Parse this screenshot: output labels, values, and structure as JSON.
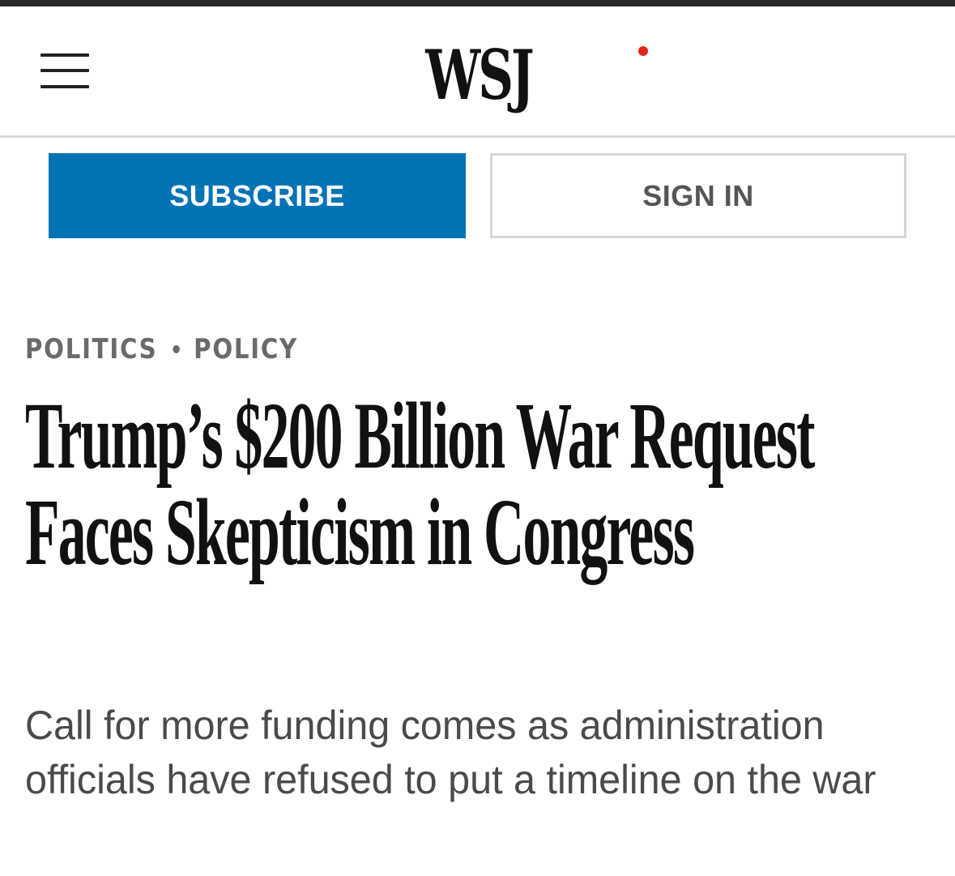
{
  "header": {
    "logo_text": "WSJ",
    "menu_icon": "hamburger-menu-icon",
    "notification_color": "#e0261b"
  },
  "auth": {
    "subscribe_label": "SUBSCRIBE",
    "signin_label": "SIGN IN",
    "accent_color": "#0274b6"
  },
  "article": {
    "section": "POLITICS",
    "subsection": "POLICY",
    "headline": "Trump’s $200 Billion War Request Faces Skepticism in Congress",
    "dek": "Call for more funding comes as administration officials have refused to put a timeline on the war"
  }
}
